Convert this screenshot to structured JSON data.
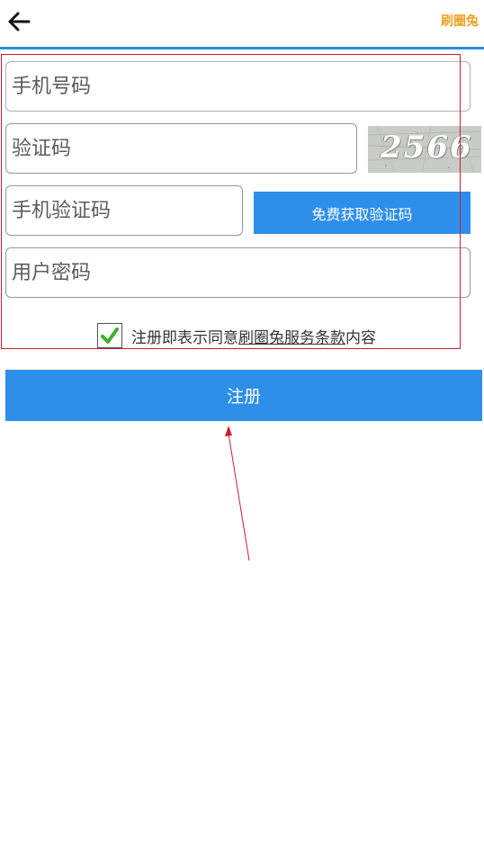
{
  "header": {
    "back_icon": "arrow-left-icon",
    "brand": "刷圈兔",
    "brand_color": "#f0a020",
    "accent_line_color": "#2a8fe0"
  },
  "form": {
    "phone_placeholder": "手机号码",
    "captcha_placeholder": "验证码",
    "captcha_text": "2566",
    "sms_code_placeholder": "手机验证码",
    "sms_button_label": "免费获取验证码",
    "password_placeholder": "用户密码",
    "agree": {
      "checked": true,
      "prefix": "注册即表示同意",
      "link": "刷圈兔服务条款",
      "suffix": "内容"
    },
    "register_label": "注册"
  },
  "colors": {
    "primary_button": "#2d8fea",
    "annotation": "#cc1f2f",
    "check": "#3fae2a"
  }
}
